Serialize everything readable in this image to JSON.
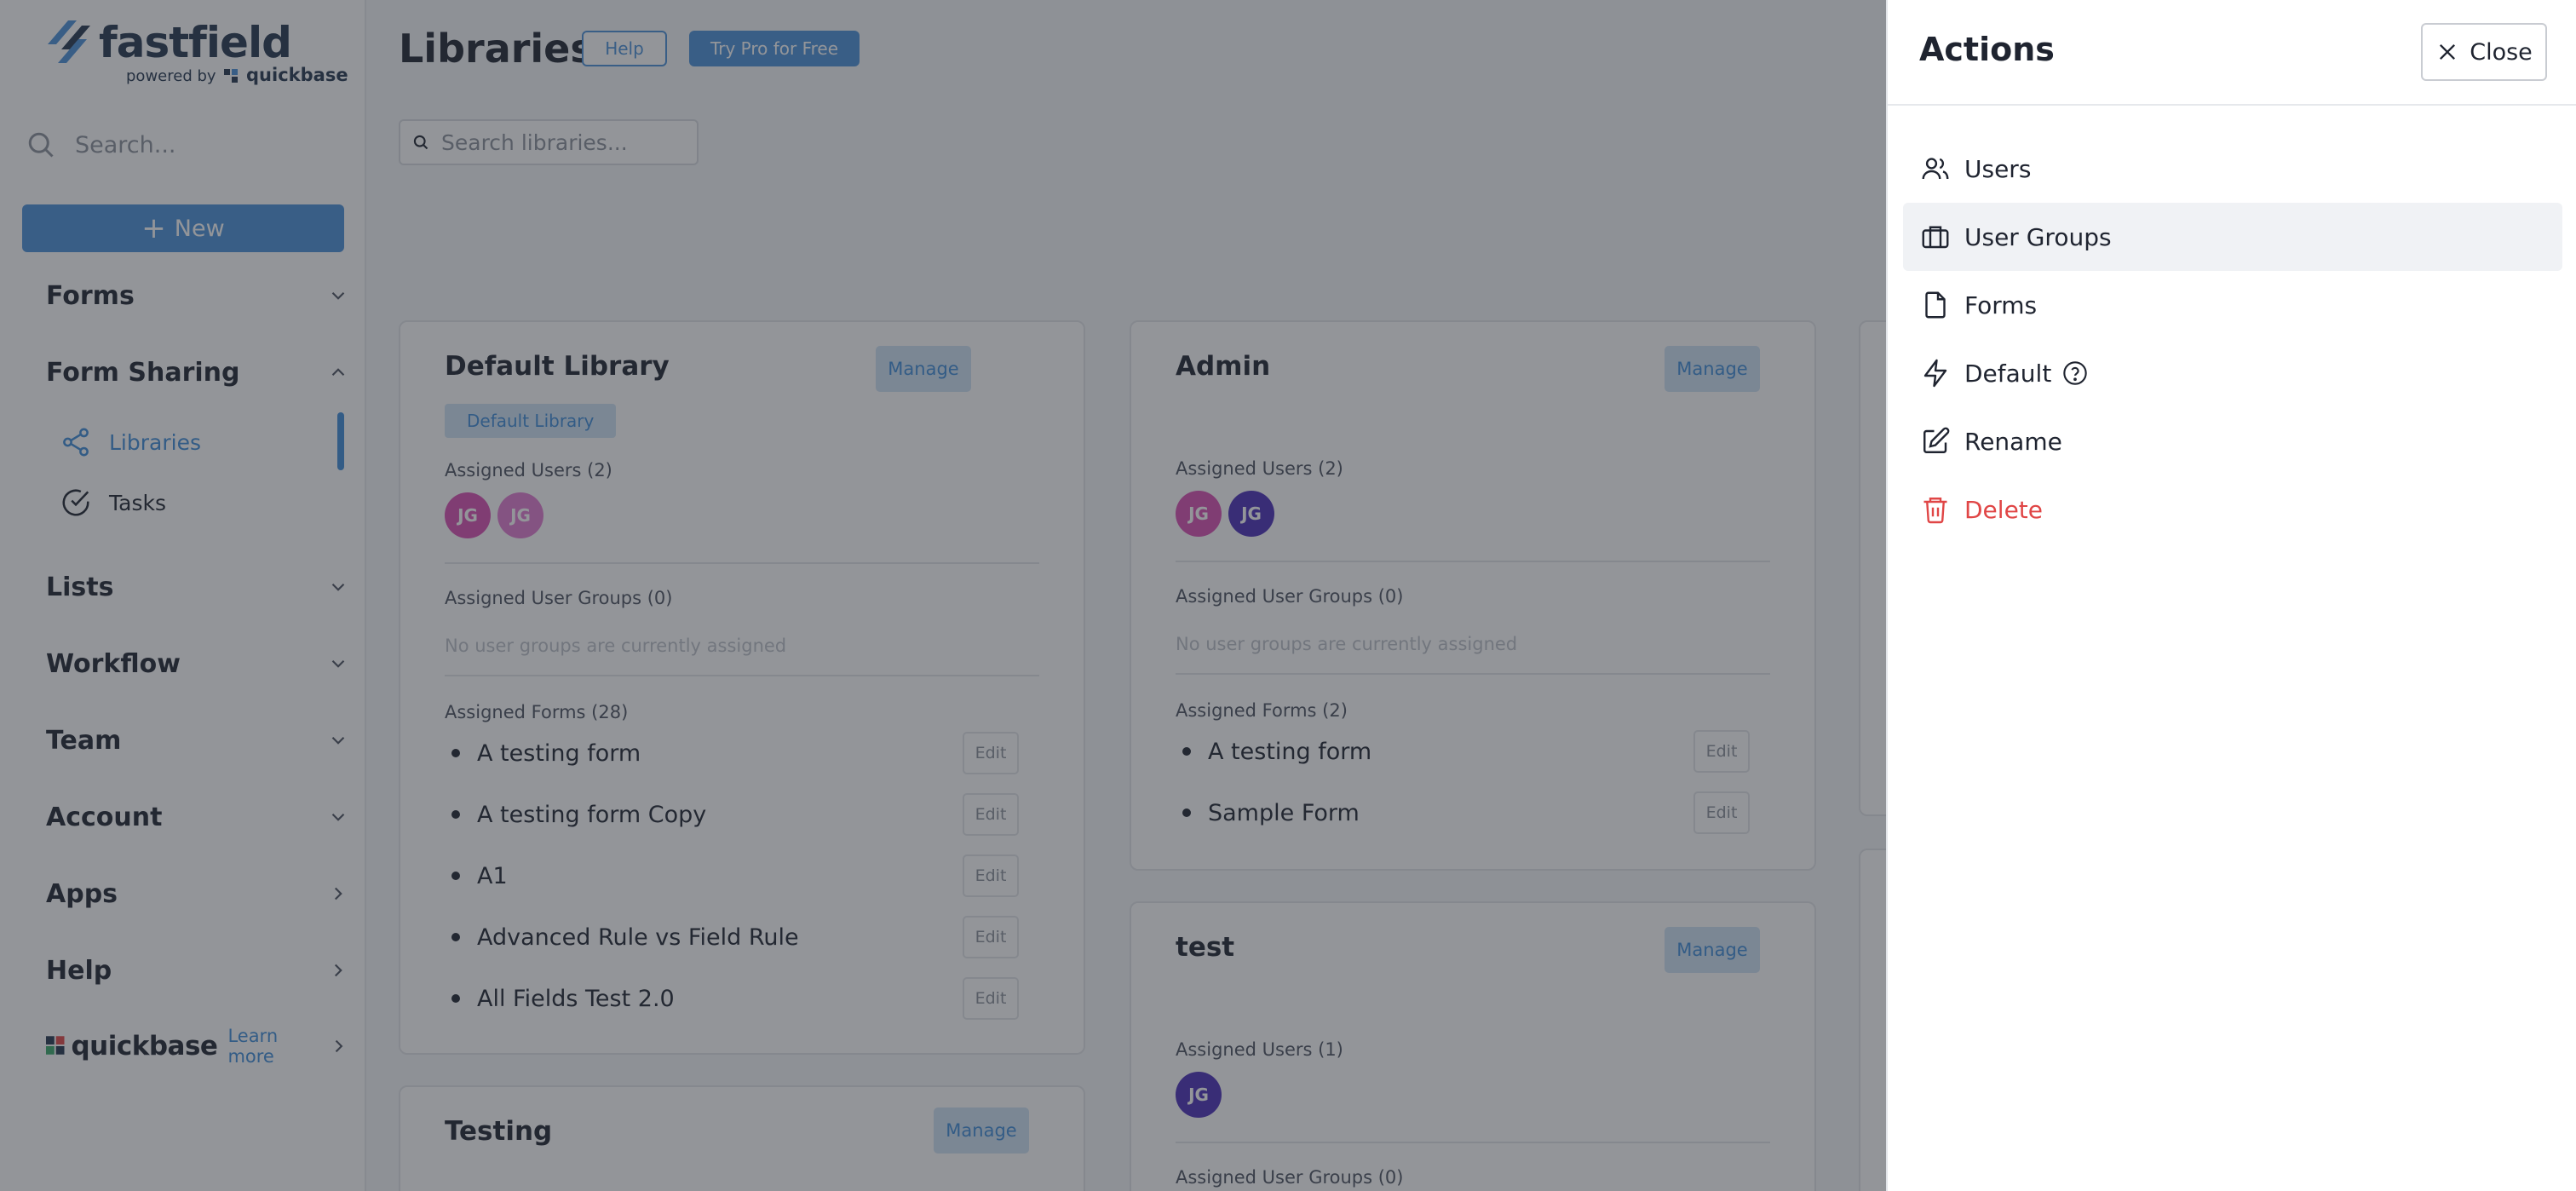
{
  "sidebar": {
    "logo_text": "fastfield",
    "logo_sub_prefix": "powered by",
    "logo_sub_brand": "quickbase",
    "search_placeholder": "Search...",
    "new_label": "New",
    "nav": {
      "forms": "Forms",
      "form_sharing": "Form Sharing",
      "libraries": "Libraries",
      "tasks": "Tasks",
      "lists": "Lists",
      "workflow": "Workflow",
      "team": "Team",
      "account": "Account",
      "apps": "Apps",
      "help": "Help"
    },
    "footer": {
      "brand": "quickbase",
      "learn_more": "Learn more"
    }
  },
  "header": {
    "title": "Libraries",
    "help_label": "Help",
    "pro_label": "Try Pro for Free",
    "search_placeholder": "Search libraries..."
  },
  "common": {
    "manage_label": "Manage",
    "edit_label": "Edit",
    "no_groups_note": "No user groups are currently assigned"
  },
  "cards": {
    "default": {
      "title": "Default Library",
      "tag": "Default Library",
      "users_label": "Assigned Users (2)",
      "avatars": [
        {
          "initials": "JG",
          "color": "#d94fb2"
        },
        {
          "initials": "JG",
          "color": "#e07ad0"
        }
      ],
      "groups_label": "Assigned User Groups (0)",
      "forms_label": "Assigned Forms (28)",
      "forms": [
        "A testing form",
        "A testing form Copy",
        "A1",
        "Advanced Rule vs Field Rule",
        "All Fields Test 2.0"
      ]
    },
    "admin": {
      "title": "Admin",
      "users_label": "Assigned Users (2)",
      "avatars": [
        {
          "initials": "JG",
          "color": "#d94fb2"
        },
        {
          "initials": "JG",
          "color": "#4a2fb8"
        }
      ],
      "groups_label": "Assigned User Groups (0)",
      "forms_label": "Assigned Forms (2)",
      "forms": [
        "A testing form",
        "Sample Form"
      ]
    },
    "test": {
      "title": "test",
      "users_label": "Assigned Users (1)",
      "avatars": [
        {
          "initials": "JG",
          "color": "#4a2fb8"
        }
      ],
      "groups_label": "Assigned User Groups (0)"
    },
    "testing": {
      "title": "Testing"
    }
  },
  "panel": {
    "title": "Actions",
    "close_label": "Close",
    "actions": {
      "users": "Users",
      "user_groups": "User Groups",
      "forms": "Forms",
      "default": "Default",
      "rename": "Rename",
      "delete": "Delete"
    }
  },
  "colors": {
    "accent": "#4a90d9",
    "danger": "#e04646",
    "overlay": "rgba(40,44,52,0.5)"
  }
}
